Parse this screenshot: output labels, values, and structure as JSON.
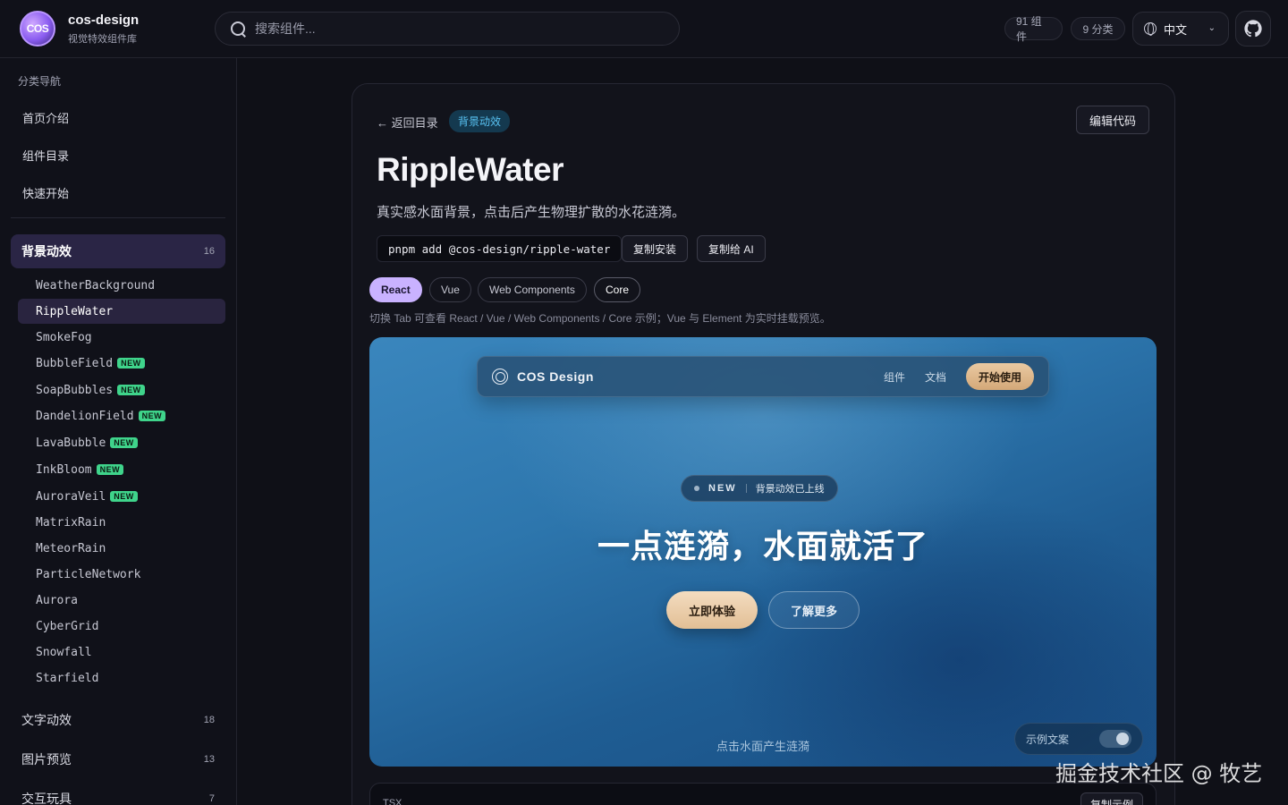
{
  "header": {
    "brand_name": "cos-design",
    "brand_sub": "视觉特效组件库",
    "logo_text": "COS",
    "search_placeholder": "搜索组件...",
    "components_count": "91 组件",
    "categories_count": "9 分类",
    "language": "中文"
  },
  "sidebar": {
    "heading": "分类导航",
    "links": [
      "首页介绍",
      "组件目录",
      "快速开始"
    ],
    "active_category": {
      "label": "背景动效",
      "count": "16"
    },
    "items": [
      {
        "label": "WeatherBackground",
        "new": ""
      },
      {
        "label": "RippleWater",
        "new": ""
      },
      {
        "label": "SmokeFog",
        "new": ""
      },
      {
        "label": "BubbleField",
        "new": "NEW"
      },
      {
        "label": "SoapBubbles",
        "new": "NEW"
      },
      {
        "label": "DandelionField",
        "new": "NEW"
      },
      {
        "label": "LavaBubble",
        "new": "NEW"
      },
      {
        "label": "InkBloom",
        "new": "NEW"
      },
      {
        "label": "AuroraVeil",
        "new": "NEW"
      },
      {
        "label": "MatrixRain",
        "new": ""
      },
      {
        "label": "MeteorRain",
        "new": ""
      },
      {
        "label": "ParticleNetwork",
        "new": ""
      },
      {
        "label": "Aurora",
        "new": ""
      },
      {
        "label": "CyberGrid",
        "new": ""
      },
      {
        "label": "Snowfall",
        "new": ""
      },
      {
        "label": "Starfield",
        "new": ""
      }
    ],
    "categories": [
      {
        "label": "文字动效",
        "count": "18"
      },
      {
        "label": "图片预览",
        "count": "13"
      },
      {
        "label": "交互玩具",
        "count": "7"
      }
    ]
  },
  "main": {
    "back_label": "← 返回目录",
    "tag": "背景动效",
    "edit_label": "编辑代码",
    "title": "RippleWater",
    "subtitle": "真实感水面背景，点击后产生物理扩散的水花涟漪。",
    "install_cmd": "pnpm add @cos-design/ripple-water",
    "copy_install": "复制安装",
    "copy_ai": "复制给 AI",
    "tabs": [
      "React",
      "Vue",
      "Web Components",
      "Core"
    ],
    "active_tab": "React",
    "tab_hint": "切换 Tab 可查看 React / Vue / Web Components / Core 示例；Vue 与 Element 为实时挂载预览。"
  },
  "preview": {
    "brand": "COS Design",
    "nav_links": [
      "组件",
      "文档"
    ],
    "cta": "开始使用",
    "badge_new": "NEW",
    "badge_text": "背景动效已上线",
    "headline": "一点涟漪，水面就活了",
    "primary_btn": "立即体验",
    "secondary_btn": "了解更多",
    "click_hint": "点击水面产生涟漪",
    "toggle_label": "示例文案",
    "toggle_on": true
  },
  "code_panel": {
    "lang": "TSX",
    "copy_label": "复制示例"
  },
  "watermark": "掘金技术社区 @ 牧艺",
  "colors": {
    "accent": "#c9b2ff",
    "tag_bg": "#14394f",
    "tag_text": "#58c2f2",
    "new_badge": "#3fd48b"
  }
}
